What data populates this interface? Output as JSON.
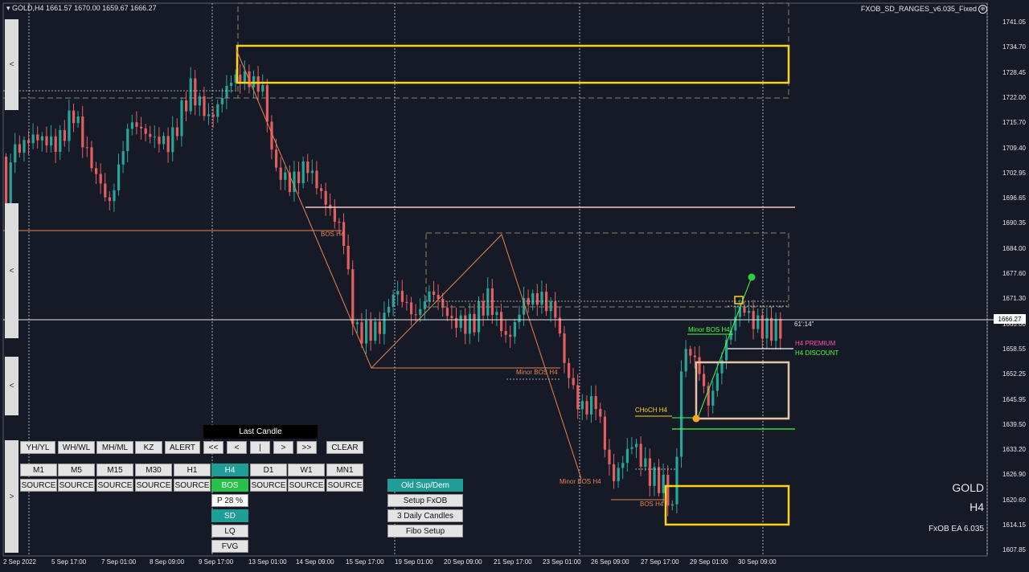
{
  "header": {
    "symbol_info": "GOLD,H4  1661.57 1670.00 1659.67 1666.27"
  },
  "indicator": {
    "name": "FXOB_SD_RANGES_v6.035_Fixed",
    "icon": "circle-settings-icon"
  },
  "price_axis": [
    "1741.05",
    "1734.70",
    "1728.45",
    "1722.00",
    "1715.70",
    "1709.40",
    "1702.95",
    "1696.65",
    "1690.35",
    "1684.00",
    "1677.60",
    "1671.30",
    "1665.00",
    "1658.55",
    "1652.25",
    "1645.95",
    "1639.50",
    "1633.20",
    "1626.90",
    "1620.60",
    "1614.15",
    "1607.85"
  ],
  "current_price": "1666.27",
  "time_axis": [
    "2 Sep 2022",
    "5 Sep 17:00",
    "7 Sep 01:00",
    "8 Sep 09:00",
    "9 Sep 17:00",
    "13 Sep 01:00",
    "14 Sep 09:00",
    "15 Sep 17:00",
    "19 Sep 01:00",
    "20 Sep 09:00",
    "21 Sep 17:00",
    "23 Sep 01:00",
    "26 Sep 09:00",
    "27 Sep 17:00",
    "29 Sep 01:00",
    "30 Sep 09:00"
  ],
  "labels": {
    "bos1": "BOS H4",
    "minor_bos1": "Minor BOS H4",
    "minor_bos2": "Minor BOS H4",
    "bos2": "BOS H4",
    "choch": "CHoCH H4",
    "minor_bos3": "Minor BOS H4",
    "countdown": "61':14\"",
    "premium": "H4 PREMIUM",
    "discount": "H4 DISCOUNT"
  },
  "panel": {
    "last_candle": "Last Candle",
    "row1": [
      "YH/YL",
      "WH/WL",
      "MH/ML",
      "KZ",
      "ALERT"
    ],
    "nav": [
      "<<",
      "<",
      "|",
      ">",
      ">>"
    ],
    "clear": "CLEAR",
    "timeframes": [
      "M1",
      "M5",
      "M15",
      "M30",
      "H1",
      "H4",
      "D1",
      "W1",
      "MN1"
    ],
    "sources": [
      "SOURCE",
      "SOURCE",
      "SOURCE",
      "SOURCE",
      "SOURCE",
      "BOS",
      "SOURCE",
      "SOURCE",
      "SOURCE"
    ],
    "h4_col": [
      "P 28 %",
      "SD",
      "LQ",
      "FVG"
    ],
    "setup": [
      "Old Sup/Dem",
      "Setup FxOB",
      "3 Daily Candles",
      "Fibo Setup"
    ]
  },
  "side_arrows": [
    "<",
    "<",
    "<",
    ">"
  ],
  "watermark": {
    "symbol": "GOLD",
    "timeframe": "H4",
    "ea": "FxOB EA 6.035"
  },
  "colors": {
    "bg": "#161a26",
    "bull": "#26a69a",
    "bear": "#e35f5f",
    "zone": "#ffd21a",
    "teal": "#1e9e96",
    "green": "#27c24a",
    "premium": "#ff4fb0",
    "discount": "#44ff44",
    "bos": "#e8834f"
  }
}
